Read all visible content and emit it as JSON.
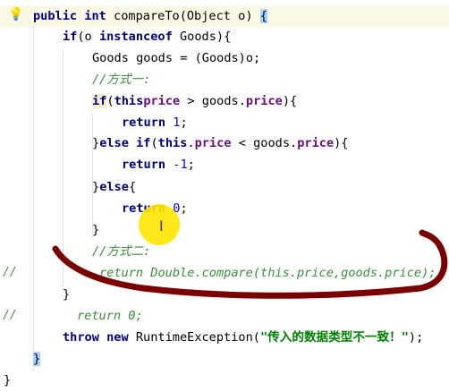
{
  "editor": {
    "lines": {
      "l1": {
        "kw": "public int ",
        "rest": "compareTo(Object o) ",
        "brace": "{"
      },
      "l2": {
        "kw": "if",
        "rest": "(o ",
        "kw2": "instanceof",
        "rest2": " Goods){"
      },
      "l3": "Goods goods = (Goods)o;",
      "l4": "//方式一:",
      "l5": {
        "kw": "if",
        "a": "(",
        "kw2": "this",
        ".": ".",
        "f1": "price",
        "b": " > goods.",
        "f2": "price",
        "c": "){"
      },
      "l6": {
        "kw": "return ",
        "num": "1",
        ";": ";"
      },
      "l7": {
        "a": "}",
        "kw": "else if",
        "b": "(",
        "kw2": "this",
        "c": ".",
        "f1": "price",
        "d": " < goods.",
        "f2": "price",
        "e": "){"
      },
      "l8": {
        "kw": "return ",
        "num": "-1",
        ";": ";"
      },
      "l9": {
        "a": "}",
        "kw": "else",
        "b": "{"
      },
      "l10": {
        "kw": "return ",
        "num": "0",
        ";": ";"
      },
      "l11": "}",
      "l12": "//方式二:",
      "l13": "return Double.compare(this.price,goods.price);",
      "l14": "}",
      "l15": "return 0;",
      "l16": {
        "kw": "throw new ",
        "rest": "RuntimeException(",
        "str": "\"传入的数据类型不一致！\"",
        "end": ");"
      },
      "l17": "}",
      "l18": "}"
    },
    "gutter_comment": "//",
    "annotation_color": "#7a0000"
  }
}
